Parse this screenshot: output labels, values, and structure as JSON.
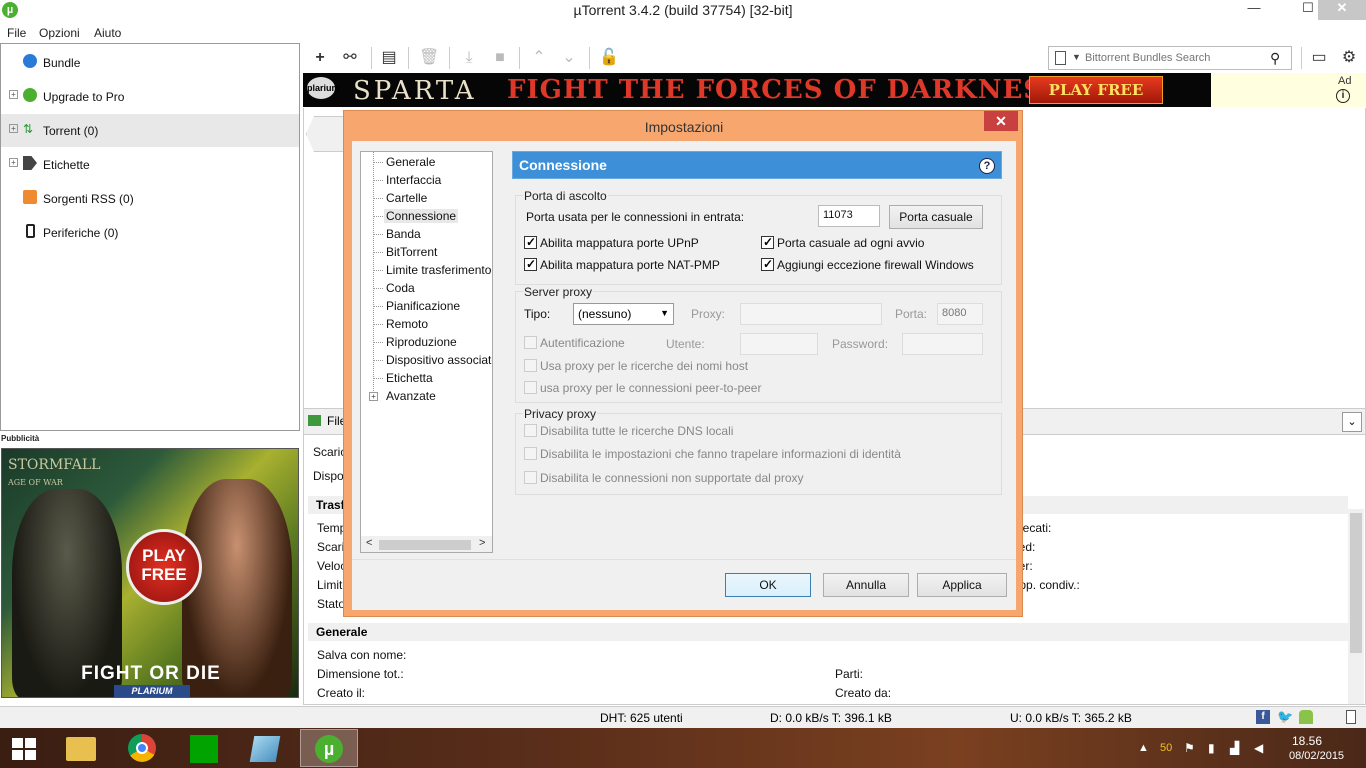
{
  "window": {
    "title": "µTorrent 3.4.2  (build 37754) [32-bit]",
    "icon": "utorrent-icon",
    "min": "—",
    "max": "☐",
    "close": "✕"
  },
  "menu": [
    "File",
    "Opzioni",
    "Aiuto"
  ],
  "sidebar": {
    "items": [
      {
        "label": "Bundle",
        "icon": "bundle-icon"
      },
      {
        "label": "Upgrade to Pro",
        "icon": "pro-icon"
      },
      {
        "label": "Torrent (0)",
        "icon": "torrent-icon"
      },
      {
        "label": "Etichette",
        "icon": "label-icon"
      },
      {
        "label": "Sorgenti RSS (0)",
        "icon": "rss-icon"
      },
      {
        "label": "Periferiche (0)",
        "icon": "device-icon"
      }
    ],
    "ad_label": "Pubblicità"
  },
  "left_ad": {
    "brand": "STORMFALL",
    "subbrand": "AGE OF WAR",
    "play": "PLAY",
    "free": "FREE",
    "slogan": "FIGHT OR DIE",
    "publisher": "PLARIUM"
  },
  "toolbar": {
    "search_placeholder": "Bittorrent Bundles Search"
  },
  "top_ad": {
    "logo": "plarium",
    "brand": "SPARTA",
    "tagline": "FIGHT THE FORCES OF DARKNESS!",
    "button": "PLAY FREE",
    "ad": "Ad",
    "info": "i"
  },
  "details": {
    "tab": "File",
    "rows": [
      "Scaricati:",
      "Disponibilità:"
    ],
    "trasf_head": "Trasferimento",
    "trasf_left": [
      "Tempo trascorso:",
      "Scaricati:",
      "Velocità download:",
      "Limite download:",
      "Stato:"
    ],
    "trasf_right": [
      "Sprecati:",
      "Seed:",
      "Peer:",
      "Rapp. condiv.:"
    ],
    "gen_head": "Generale",
    "gen_left": [
      "Salva con nome:",
      "Dimensione tot.:",
      "Creato il:"
    ],
    "gen_right": [
      "Parti:",
      "Creato da:"
    ],
    "collapse": "⌄"
  },
  "statusbar": {
    "dht": "DHT: 625 utenti",
    "down": "D: 0.0 kB/s T: 396.1 kB",
    "up": "U: 0.0 kB/s T: 365.2 kB"
  },
  "taskbar": {
    "time": "18.56",
    "date": "08/02/2015",
    "badge": "50"
  },
  "dialog": {
    "title": "Impostazioni",
    "close": "✕",
    "tree": [
      "Generale",
      "Interfaccia",
      "Cartelle",
      "Connessione",
      "Banda",
      "BitTorrent",
      "Limite trasferimento",
      "Coda",
      "Pianificazione",
      "Remoto",
      "Riproduzione",
      "Dispositivo associato",
      "Etichetta",
      "Avanzate"
    ],
    "tree_selected": "Connessione",
    "section": "Connessione",
    "listen": {
      "group": "Porta di ascolto",
      "port_label": "Porta usata per le connessioni in entrata:",
      "port_value": "11073",
      "random_button": "Porta casuale",
      "upnp": "Abilita mappatura porte UPnP",
      "natpmp": "Abilita mappatura porte NAT-PMP",
      "random_start": "Porta casuale ad ogni avvio",
      "firewall": "Aggiungi eccezione firewall Windows"
    },
    "proxy": {
      "group": "Server proxy",
      "type_label": "Tipo:",
      "type_value": "(nessuno)",
      "proxy_label": "Proxy:",
      "port_label": "Porta:",
      "port_value": "8080",
      "auth": "Autentificazione",
      "user_label": "Utente:",
      "pass_label": "Password:",
      "dns": "Usa proxy per le ricerche dei nomi host",
      "p2p": "usa proxy per le connessioni peer-to-peer"
    },
    "privacy": {
      "group": "Privacy proxy",
      "dns_off": "Disabilita tutte le ricerche DNS locali",
      "leak_off": "Disabilita le impostazioni che fanno trapelare informazioni di identità",
      "unsupported_off": "Disabilita le connessioni non supportate dal proxy"
    },
    "buttons": {
      "ok": "OK",
      "cancel": "Annulla",
      "apply": "Applica"
    }
  }
}
